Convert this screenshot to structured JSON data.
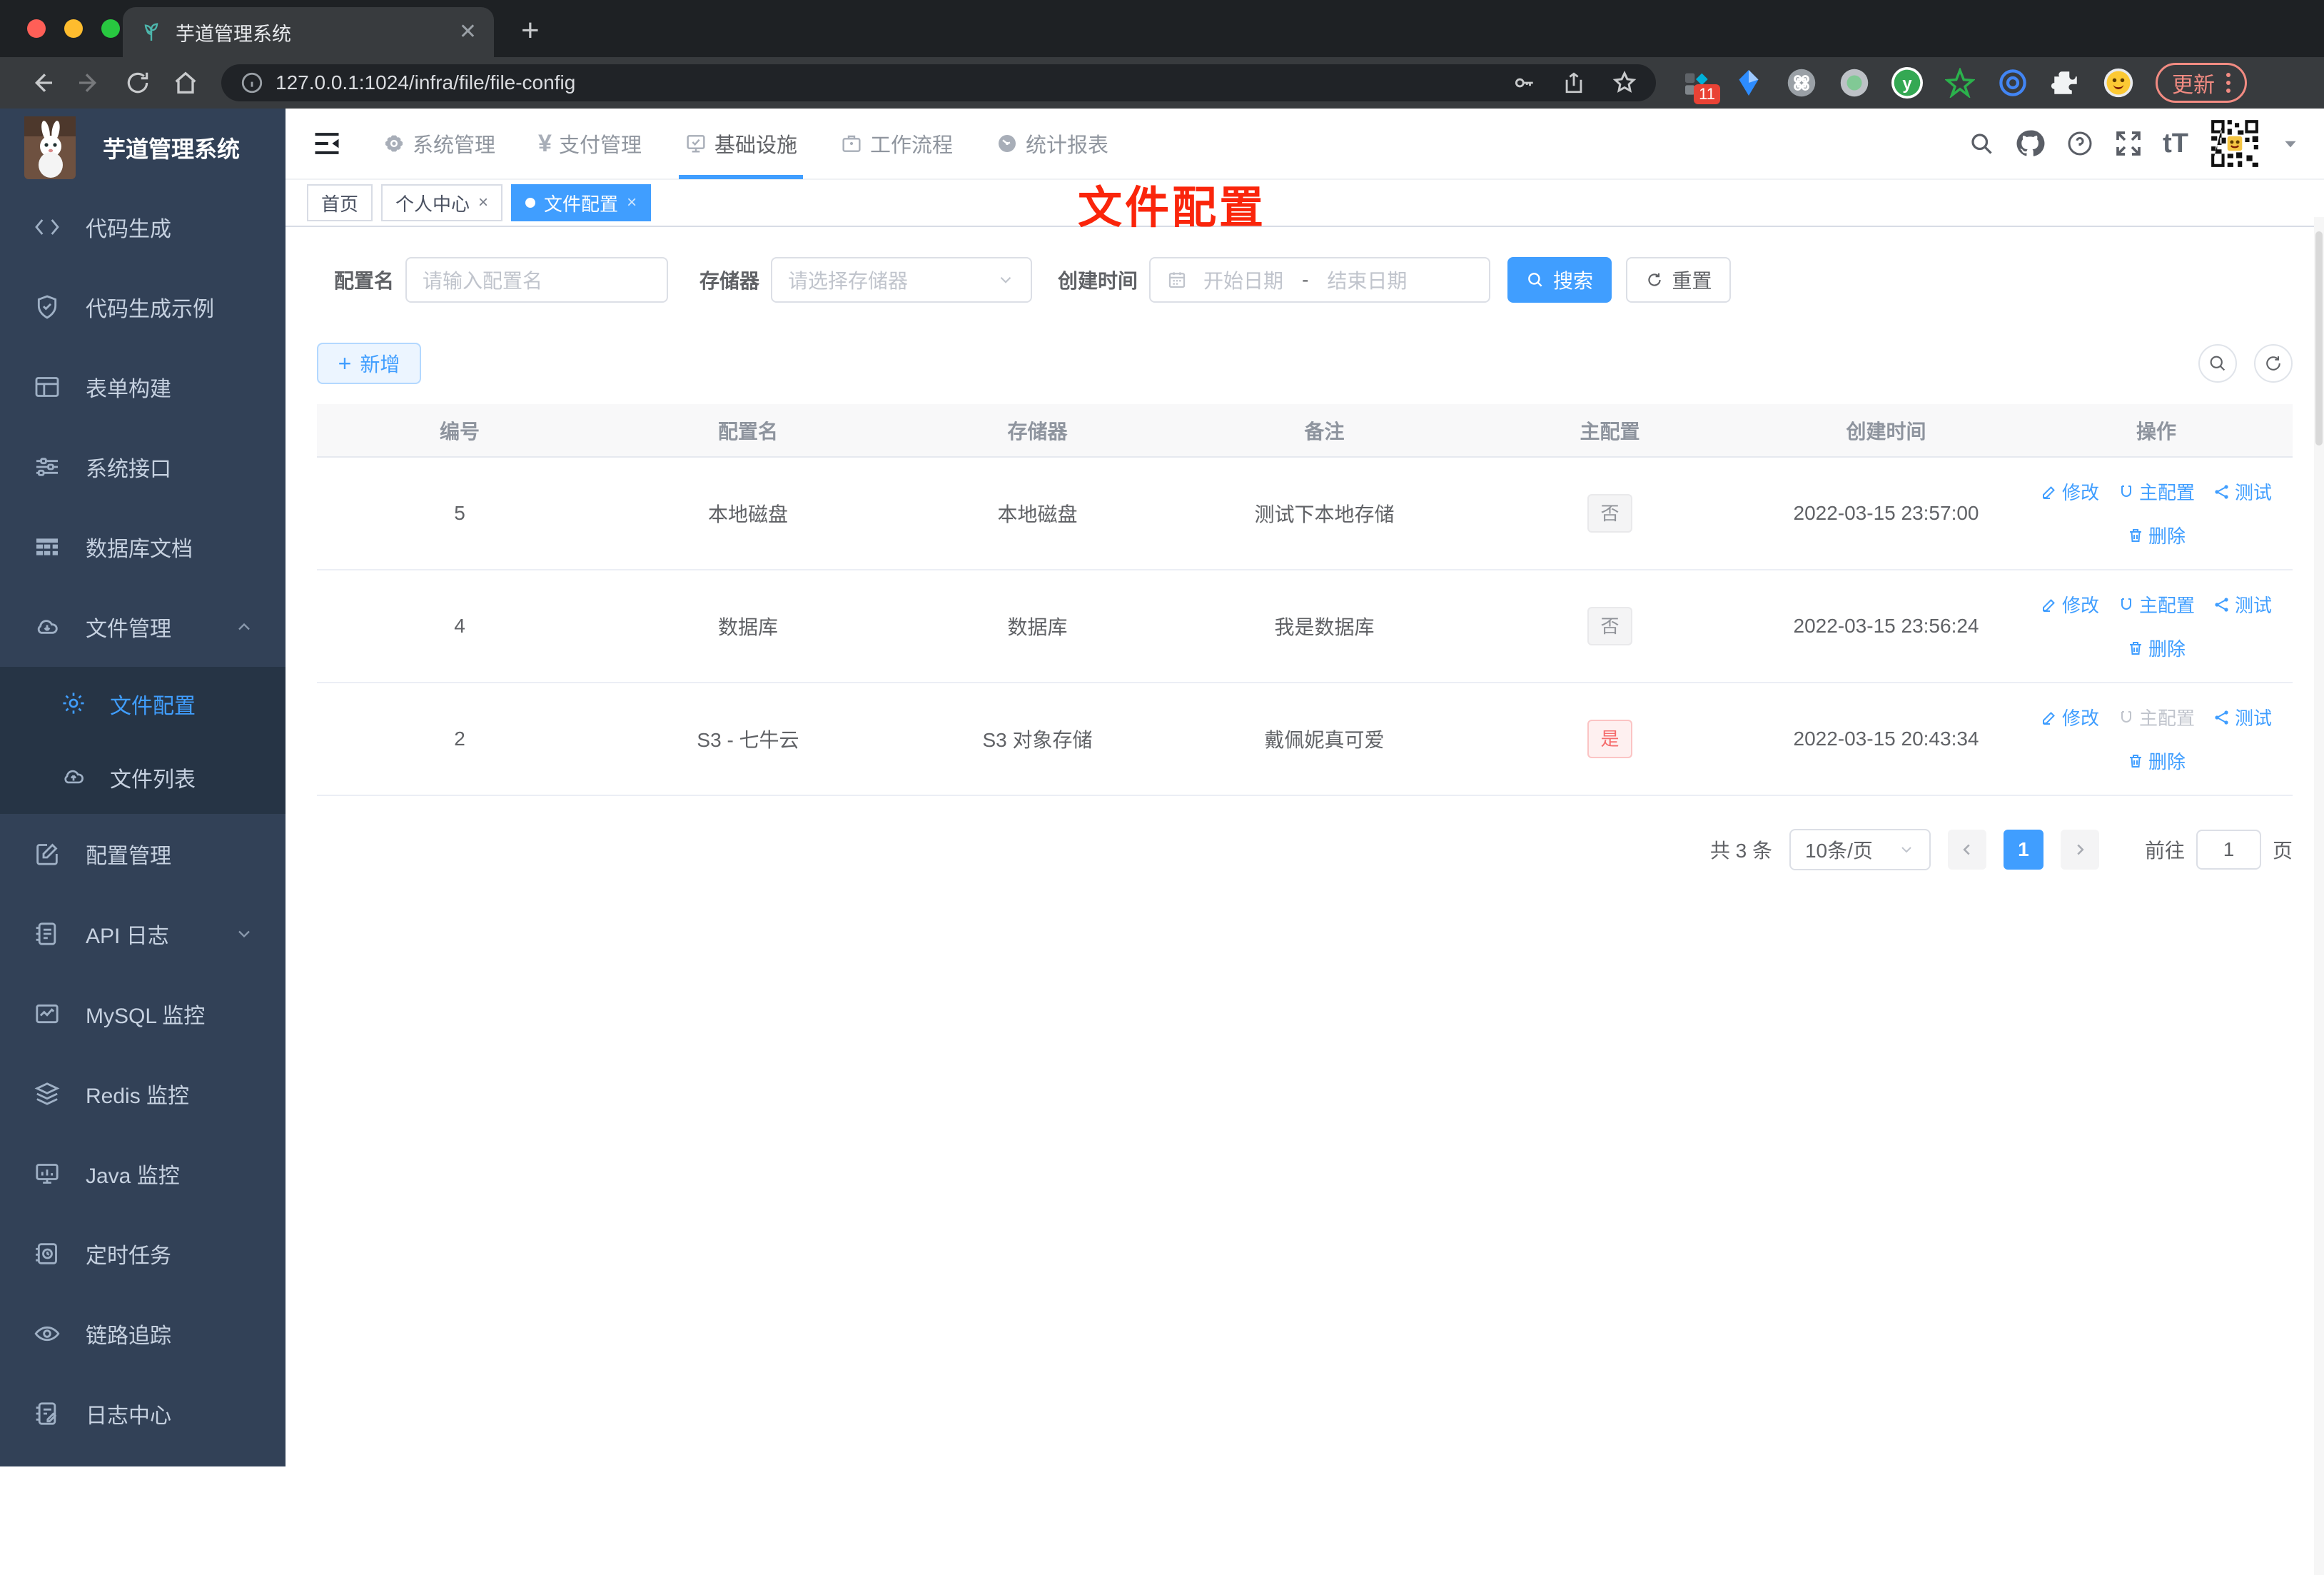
{
  "browser": {
    "tab_title": "芋道管理系统",
    "url": "127.0.0.1:1024/infra/file/file-config",
    "extension_badge": "11",
    "update_label": "更新"
  },
  "sidebar": {
    "title": "芋道管理系统",
    "items": [
      {
        "label": "代码生成"
      },
      {
        "label": "代码生成示例"
      },
      {
        "label": "表单构建"
      },
      {
        "label": "系统接口"
      },
      {
        "label": "数据库文档"
      },
      {
        "label": "文件管理"
      },
      {
        "label": "文件配置"
      },
      {
        "label": "文件列表"
      },
      {
        "label": "配置管理"
      },
      {
        "label": "API 日志"
      },
      {
        "label": "MySQL 监控"
      },
      {
        "label": "Redis 监控"
      },
      {
        "label": "Java 监控"
      },
      {
        "label": "定时任务"
      },
      {
        "label": "链路追踪"
      },
      {
        "label": "日志中心"
      }
    ]
  },
  "topnav": {
    "items": [
      {
        "label": "系统管理"
      },
      {
        "label": "支付管理"
      },
      {
        "label": "基础设施"
      },
      {
        "label": "工作流程"
      },
      {
        "label": "统计报表"
      }
    ],
    "pay_symbol": "¥",
    "font_size_icon": "tT"
  },
  "tags": [
    {
      "label": "首页"
    },
    {
      "label": "个人中心"
    },
    {
      "label": "文件配置"
    }
  ],
  "annotation": "文件配置",
  "filter": {
    "name_label": "配置名",
    "name_placeholder": "请输入配置名",
    "storage_label": "存储器",
    "storage_placeholder": "请选择存储器",
    "date_label": "创建时间",
    "date_start_placeholder": "开始日期",
    "date_separator": "-",
    "date_end_placeholder": "结束日期",
    "search_label": "搜索",
    "reset_label": "重置"
  },
  "actions_bar": {
    "add_label": "新增"
  },
  "table": {
    "headers": [
      "编号",
      "配置名",
      "存储器",
      "备注",
      "主配置",
      "创建时间",
      "操作"
    ],
    "action_labels": {
      "edit": "修改",
      "master": "主配置",
      "test": "测试",
      "delete": "删除"
    },
    "rows": [
      {
        "id": "5",
        "name": "本地磁盘",
        "storage": "本地磁盘",
        "remark": "测试下本地存储",
        "master": "否",
        "create_time": "2022-03-15 23:57:00"
      },
      {
        "id": "4",
        "name": "数据库",
        "storage": "数据库",
        "remark": "我是数据库",
        "master": "否",
        "create_time": "2022-03-15 23:56:24"
      },
      {
        "id": "2",
        "name": "S3 - 七牛云",
        "storage": "S3 对象存储",
        "remark": "戴佩妮真可爱",
        "master": "是",
        "create_time": "2022-03-15 20:43:34"
      }
    ]
  },
  "pagination": {
    "total": "共 3 条",
    "page_size": "10条/页",
    "current_page": "1",
    "goto_label": "前往",
    "goto_value": "1",
    "page_unit": "页"
  },
  "colors": {
    "accent": "#409eff",
    "annotation_red": "#fa250b",
    "danger": "#f56c6c"
  }
}
